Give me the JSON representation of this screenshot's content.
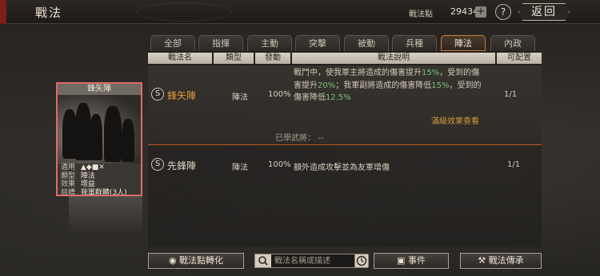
{
  "header": {
    "title": "戰法",
    "points_label": "戰法點",
    "points_value": "29434",
    "plus_symbol": "+",
    "help_symbol": "?",
    "back_label": "返回"
  },
  "tabs": [
    {
      "label": "全部",
      "active": false
    },
    {
      "label": "指揮",
      "active": false
    },
    {
      "label": "主動",
      "active": false
    },
    {
      "label": "突擊",
      "active": false
    },
    {
      "label": "被動",
      "active": false
    },
    {
      "label": "兵種",
      "active": false
    },
    {
      "label": "陣法",
      "active": true
    },
    {
      "label": "內政",
      "active": false
    }
  ],
  "table": {
    "headers": {
      "name": "戰法名",
      "type": "類型",
      "rate": "發動",
      "desc": "戰法說明",
      "config": "可配置"
    },
    "rows": [
      {
        "grade": "S",
        "name": "鋒矢陣",
        "type": "陣法",
        "rate": "100%",
        "desc": {
          "p1": "戰鬥中，使我軍主將造成的傷害提升",
          "v1": "15%",
          "p2": "，受到的傷害提升",
          "v2": "20%",
          "p3": "；我軍副將造成的傷害降低",
          "v3": "15%",
          "p4": "，受到的傷害降低",
          "v4": "12.5%"
        },
        "config": "1/1",
        "max_effect_link": "滿級效果查看",
        "learned_label": "已學武將：",
        "learned_value": "--"
      },
      {
        "grade": "S",
        "name": "先鋒陣",
        "type": "陣法",
        "rate": "100%",
        "desc_text": "額外造成攻擊並為友軍增傷",
        "config": "1/1"
      }
    ]
  },
  "card": {
    "title": "鋒矢陣",
    "info": [
      {
        "key": "適用",
        "value": "▲◆■✕"
      },
      {
        "key": "類型",
        "value": "陣法"
      },
      {
        "key": "效果",
        "value": "增益"
      },
      {
        "key": "目標",
        "value": "我軍群體(3人)"
      }
    ]
  },
  "bottom": {
    "convert_label": "戰法點轉化",
    "search_placeholder": "戰法名稱或描述",
    "event_label": "事件",
    "inherit_label": "戰法傳承"
  }
}
